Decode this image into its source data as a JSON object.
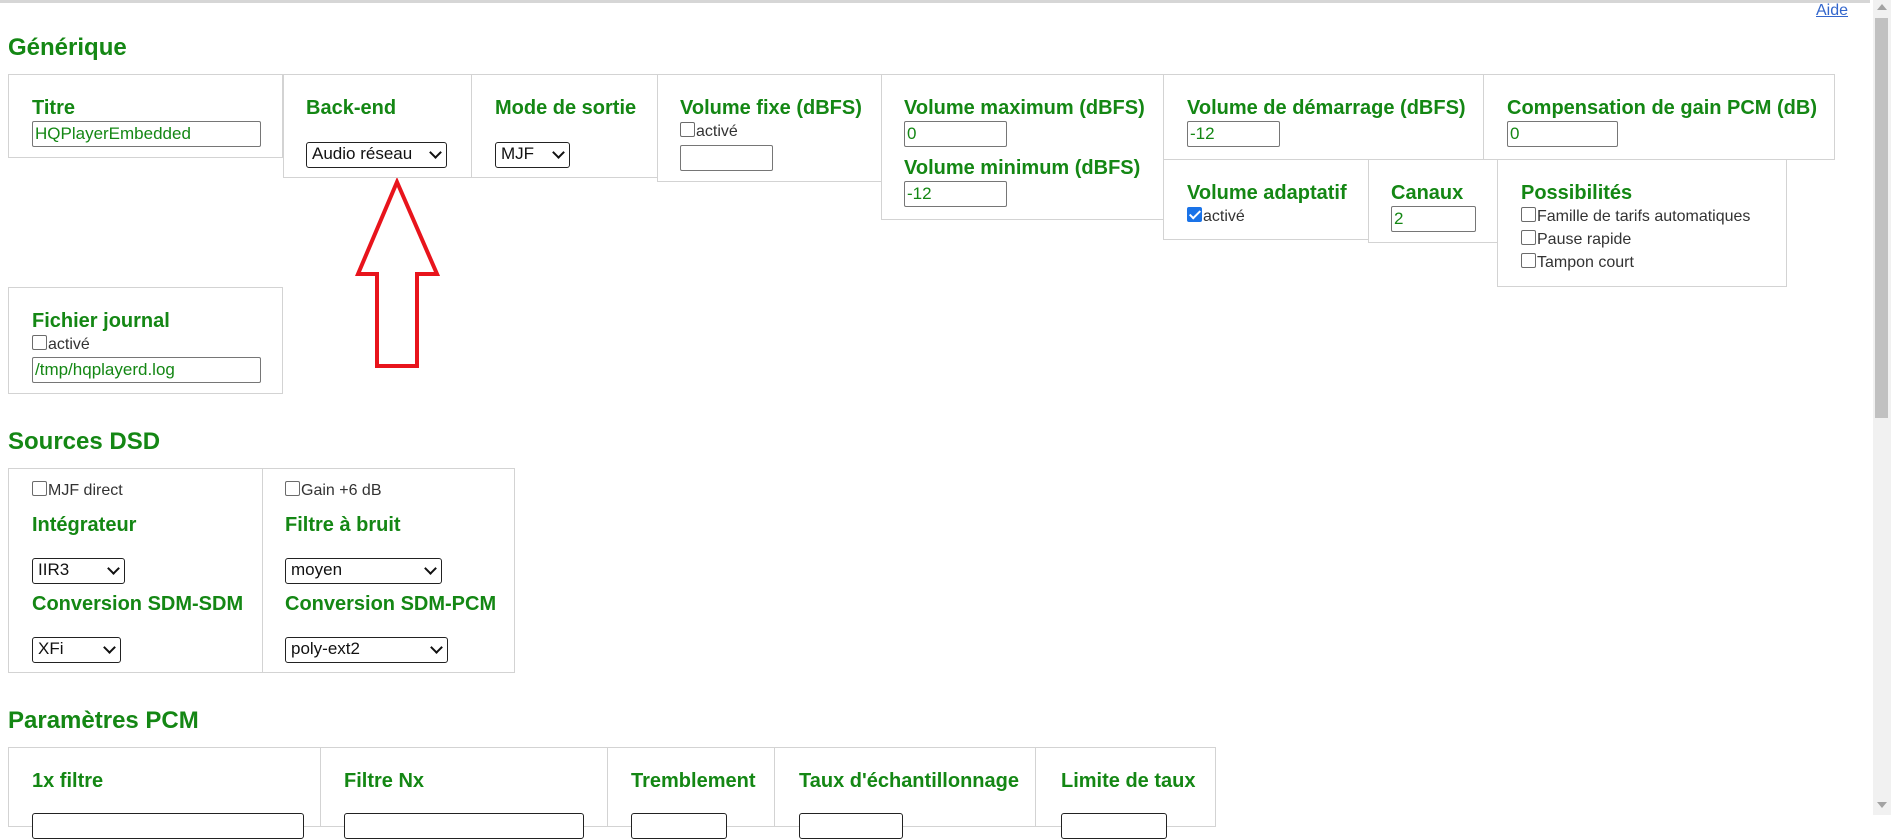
{
  "help_link": "Aide",
  "sections": {
    "generic": "Générique",
    "dsd": "Sources DSD",
    "pcm": "Paramètres PCM"
  },
  "generic": {
    "title": {
      "label": "Titre",
      "value": "HQPlayerEmbedded"
    },
    "backend": {
      "label": "Back-end",
      "value": "Audio réseau"
    },
    "output_mode": {
      "label": "Mode de sortie",
      "value": "MJF"
    },
    "fixed_volume": {
      "label": "Volume fixe (dBFS)",
      "enabled_label": "activé",
      "enabled": false,
      "value": ""
    },
    "max_volume": {
      "label": "Volume maximum (dBFS)",
      "value": "0"
    },
    "min_volume": {
      "label": "Volume minimum (dBFS)",
      "value": "-12"
    },
    "start_volume": {
      "label": "Volume de démarrage (dBFS)",
      "value": "-12"
    },
    "pcm_gain": {
      "label": "Compensation de gain PCM (dB)",
      "value": "0"
    },
    "adaptive_volume": {
      "label": "Volume adaptatif",
      "enabled_label": "activé",
      "enabled": true
    },
    "channels": {
      "label": "Canaux",
      "value": "2"
    },
    "possibilities": {
      "label": "Possibilités",
      "options": [
        {
          "label": "Famille de tarifs automatiques",
          "checked": false
        },
        {
          "label": "Pause rapide",
          "checked": false
        },
        {
          "label": "Tampon court",
          "checked": false
        }
      ]
    },
    "log_file": {
      "label": "Fichier journal",
      "enabled_label": "activé",
      "enabled": false,
      "value": "/tmp/hqplayerd.log"
    }
  },
  "dsd": {
    "direct": {
      "label": "MJF direct",
      "checked": false
    },
    "gain": {
      "label": "Gain +6 dB",
      "checked": false
    },
    "integrator": {
      "label": "Intégrateur",
      "value": "IIR3"
    },
    "noise_filter": {
      "label": "Filtre à bruit",
      "value": "moyen"
    },
    "sdm_sdm": {
      "label": "Conversion SDM-SDM",
      "value": "XFi"
    },
    "sdm_pcm": {
      "label": "Conversion SDM-PCM",
      "value": "poly-ext2"
    }
  },
  "pcm": {
    "headers": [
      "1x filtre",
      "Filtre Nx",
      "Tremblement",
      "Taux d'échantillonnage",
      "Limite de taux"
    ]
  },
  "annotation_color": "#e8141c"
}
